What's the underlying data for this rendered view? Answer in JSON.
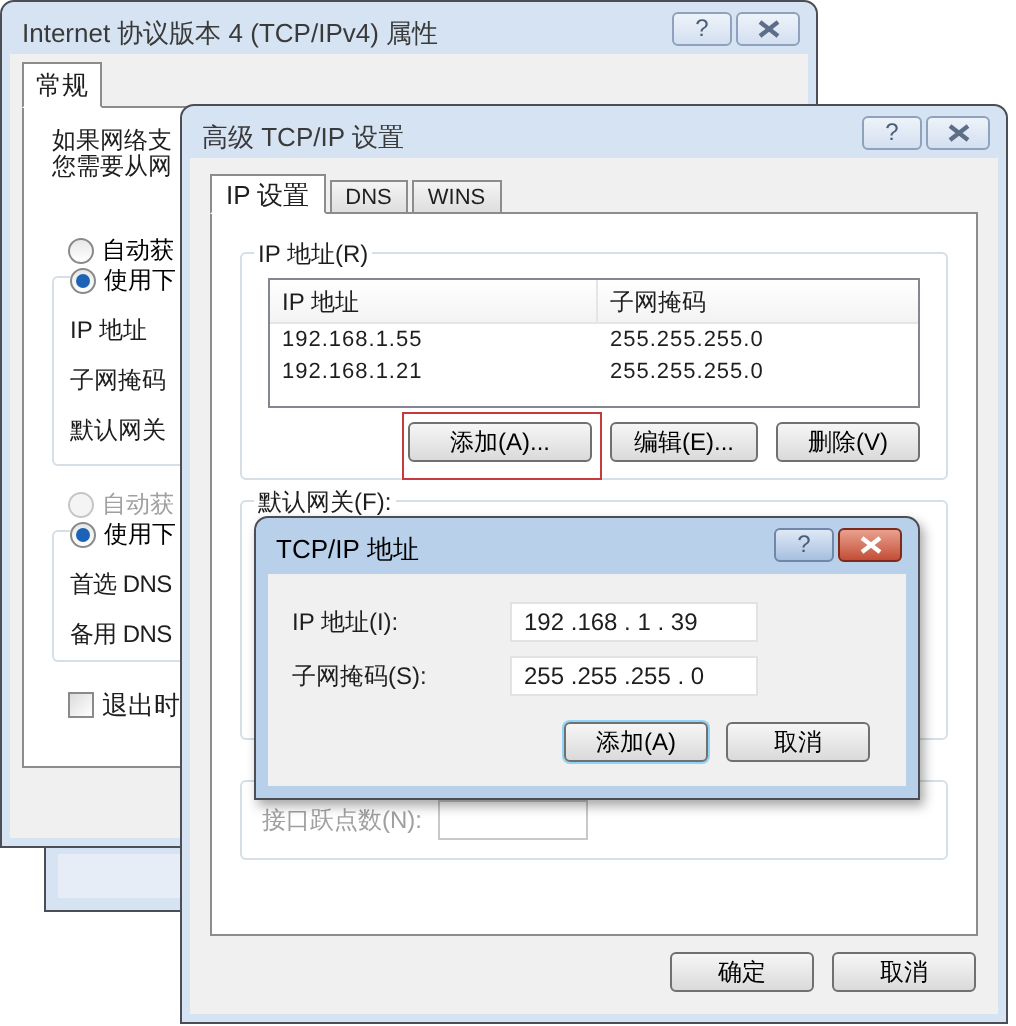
{
  "properties_window": {
    "title": "Internet 协议版本 4 (TCP/IPv4) 属性",
    "active": false,
    "help_button": "?",
    "tabs": [
      {
        "label": "常规",
        "selected": true
      }
    ],
    "intro_lines": [
      "如果网络支",
      "您需要从网"
    ],
    "ip_options": [
      {
        "label": "自动获",
        "selected": false,
        "disabled": false
      },
      {
        "label": "使用下",
        "selected": true,
        "disabled": false
      }
    ],
    "ip_fields": [
      "IP 地址",
      "子网掩码",
      "默认网关"
    ],
    "dns_options": [
      {
        "label": "自动获",
        "selected": false,
        "disabled": true
      },
      {
        "label": "使用下",
        "selected": true,
        "disabled": false
      }
    ],
    "dns_fields": [
      "首选 DNS",
      "备用 DNS"
    ],
    "exit_checkbox": {
      "label": "退出时",
      "checked": false
    }
  },
  "advanced_window": {
    "title": "高级 TCP/IP 设置",
    "active": false,
    "help_button": "?",
    "tabs": [
      {
        "label": "IP 设置",
        "selected": true
      },
      {
        "label": "DNS",
        "selected": false
      },
      {
        "label": "WINS",
        "selected": false
      }
    ],
    "ip_group": {
      "title": "IP 地址(R)",
      "columns": [
        "IP 地址",
        "子网掩码"
      ],
      "rows": [
        [
          "192.168.1.55",
          "255.255.255.0"
        ],
        [
          "192.168.1.21",
          "255.255.255.0"
        ]
      ],
      "buttons": [
        {
          "label": "添加(A)...",
          "highlighted": true
        },
        {
          "label": "编辑(E)...",
          "highlighted": false
        },
        {
          "label": "删除(V)",
          "highlighted": false
        }
      ]
    },
    "gateway_group": {
      "title": "默认网关(F):"
    },
    "metric": {
      "label": "接口跃点数(N):",
      "disabled": true
    },
    "buttons": [
      "确定",
      "取消"
    ]
  },
  "address_dialog": {
    "title": "TCP/IP 地址",
    "active": true,
    "help_button": "?",
    "fields": [
      {
        "label": "IP 地址(I):",
        "value": "192 .168 . 1 . 39"
      },
      {
        "label": "子网掩码(S):",
        "value": "255 .255 .255 . 0"
      }
    ],
    "buttons": [
      {
        "label": "添加(A)",
        "default": true
      },
      {
        "label": "取消",
        "default": false
      }
    ]
  }
}
